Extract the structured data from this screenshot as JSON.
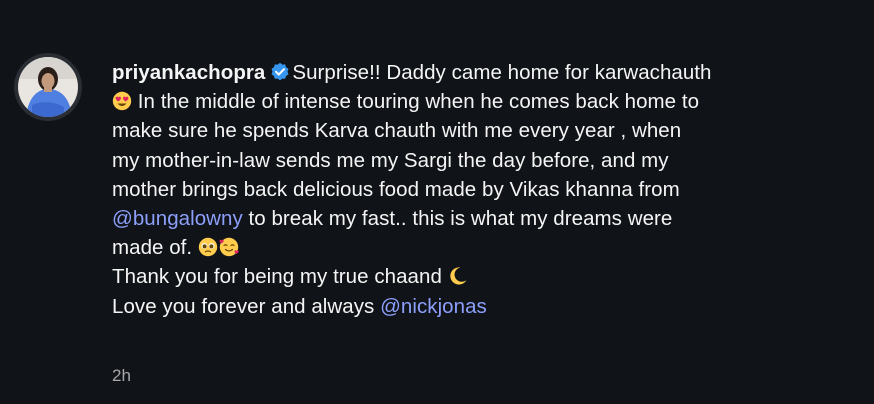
{
  "comment": {
    "username": "priyankachopra",
    "verified": true,
    "lines": {
      "l1_text": "Surprise!! Daddy came home for karwachauth",
      "l2_text": " In the middle of intense touring when he comes back home to",
      "l3_text": "make sure he spends Karva chauth with me every year , when",
      "l4_text": "my mother-in-law sends me my Sargi the day before, and my",
      "l5_text": "mother brings back delicious food made by Vikas khanna from",
      "l6_mention": "@bungalowny",
      "l6_text": " to break my fast.. this is what my dreams were",
      "l7_text": "made of. ",
      "l8_text": "Thank you for being my true chaand ",
      "l9_text": "Love you forever and always ",
      "l9_mention": "@nickjonas"
    },
    "emojis": {
      "heart_eyes": "heart-eyes-emoji",
      "pleading": "pleading-face-emoji",
      "hearts_face": "smiling-face-with-hearts-emoji",
      "moon": "crescent-moon-emoji"
    },
    "timestamp": "2h"
  },
  "colors": {
    "background": "#101318",
    "text": "#f5f5f5",
    "mention": "#8c9ffb",
    "muted": "#a8a8a8",
    "verified_badge": "#3797f0"
  }
}
